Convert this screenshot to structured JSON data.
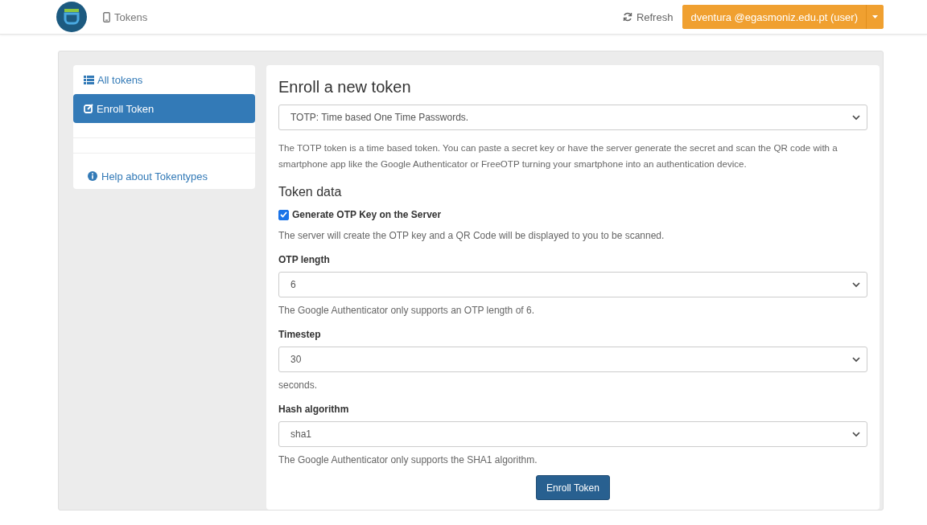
{
  "header": {
    "nav_item": "Tokens",
    "refresh": "Refresh",
    "user": "dventura @egasmoniz.edu.pt (user)"
  },
  "sidebar": {
    "items": [
      {
        "label": "All tokens",
        "selected": false
      },
      {
        "label": "Enroll Token",
        "selected": true
      }
    ],
    "help": "Help about Tokentypes"
  },
  "form": {
    "title": "Enroll a new token",
    "token_type": "TOTP: Time based One Time Passwords.",
    "description": "The TOTP token is a time based token. You can paste a secret key or have the server generate the secret and scan the QR code with a smartphone app like the Google Authenticator or FreeOTP turning your smartphone into an authentication device.",
    "section": "Token data",
    "generate": {
      "label": "Generate OTP Key on the Server",
      "checked": true,
      "help": "The server will create the OTP key and a QR Code will be displayed to you to be scanned."
    },
    "fields": [
      {
        "label": "OTP length",
        "value": "6",
        "help": "The Google Authenticator only supports an OTP length of 6."
      },
      {
        "label": "Timestep",
        "value": "30",
        "help": "seconds."
      },
      {
        "label": "Hash algorithm",
        "value": "sha1",
        "help": "The Google Authenticator only supports the SHA1 algorithm."
      }
    ],
    "submit": "Enroll Token"
  }
}
